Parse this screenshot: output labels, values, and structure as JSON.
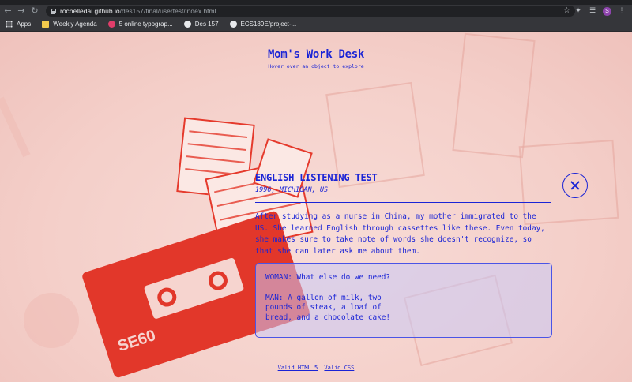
{
  "browser": {
    "url_host": "rochelledai.github.io",
    "url_path": "/des157/final/usertest/index.html",
    "profile_initial": "S",
    "bookmarks": [
      {
        "label": "Apps",
        "icon": "apps-grid-icon"
      },
      {
        "label": "Weekly Agenda",
        "icon": "folder-icon"
      },
      {
        "label": "5 online typograp...",
        "icon": "bookmark-favicon-icon"
      },
      {
        "label": "Des 157",
        "icon": "bookmark-favicon-icon"
      },
      {
        "label": "ECS189E/project-...",
        "icon": "github-icon"
      }
    ]
  },
  "header": {
    "title": "Mom's Work Desk",
    "subtitle": "Hover over an object to explore"
  },
  "panel": {
    "title": "ENGLISH LISTENING TEST",
    "meta": "1996, MICHIGAN, US",
    "description": "After studying as a nurse in China, my mother immigrated to the US. She learned English through cassettes like these. Even today, she makes sure to take note of words she doesn't recognize, so that she can later ask me about them.",
    "dialog": {
      "line1": "WOMAN: What else do we need?",
      "line2": "MAN: A gallon of milk, two\npounds of steak, a loaf of\nbread, and a chocolate cake!"
    }
  },
  "footer": {
    "link1": "Valid HTML 5",
    "link2": "Valid CSS"
  },
  "colors": {
    "accent": "#1a24d6",
    "background": "#f6d4cf",
    "collage_red": "#e2372a"
  }
}
